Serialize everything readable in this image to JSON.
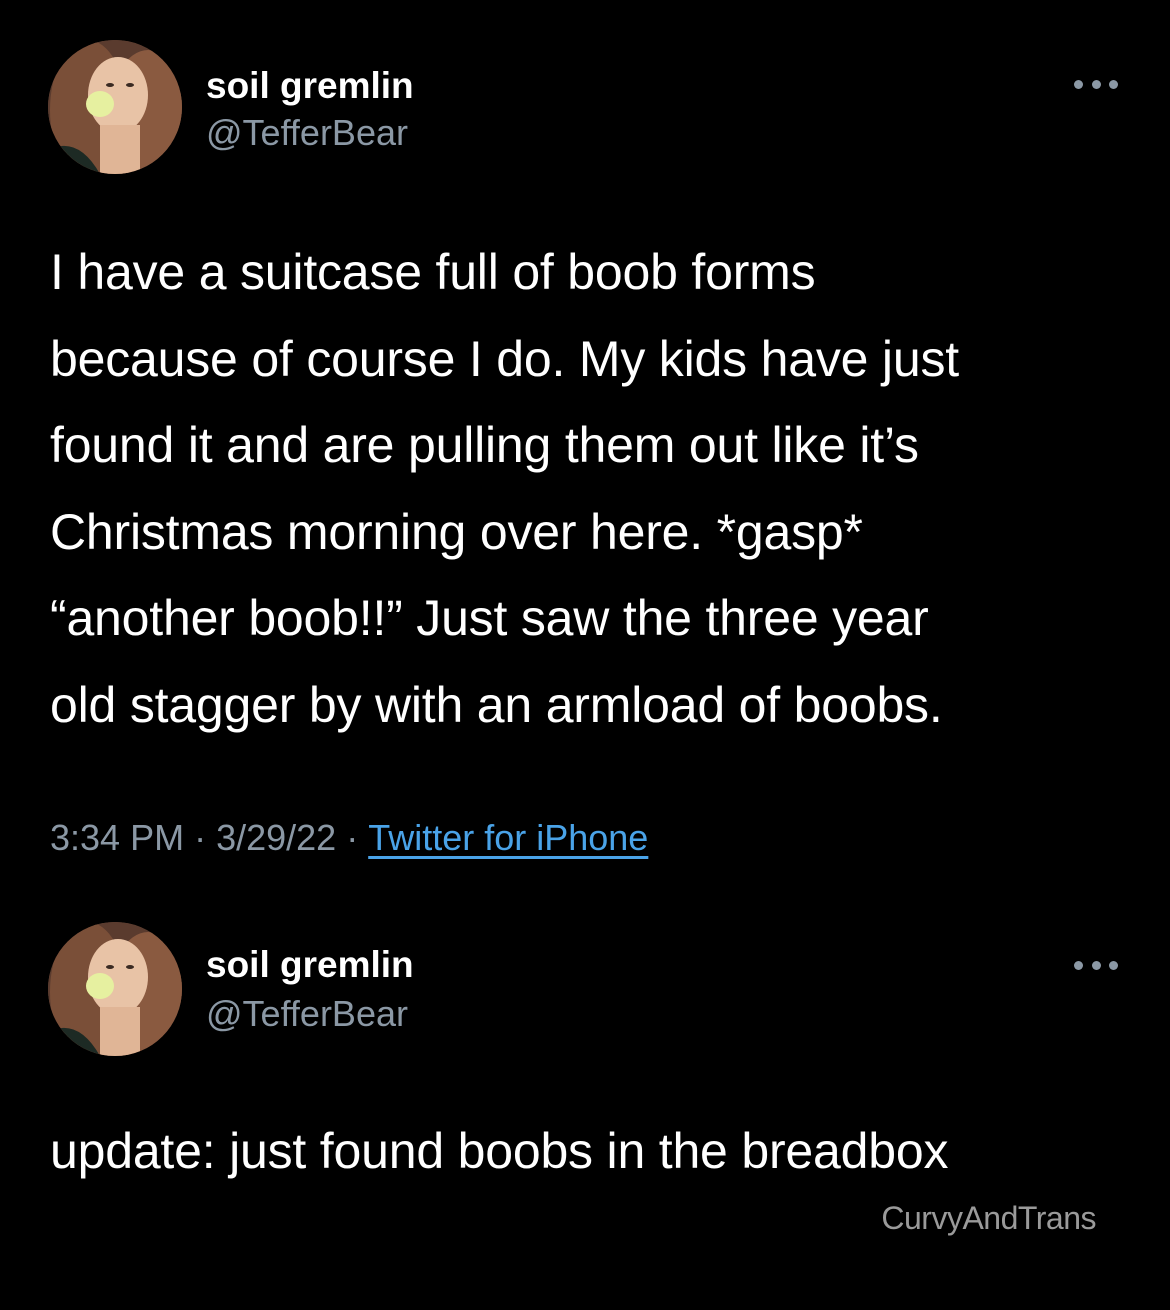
{
  "tweets": [
    {
      "display_name": "soil gremlin",
      "handle": "@TefferBear",
      "text": "I have a suitcase full of boob forms\nbecause of course I do. My kids have just\nfound it and are pulling them out like it’s\nChristmas morning over here. *gasp*\n“another boob!!” Just saw the three year\nold stagger by with an armload of boobs.",
      "time": "3:34 PM",
      "separator": "·",
      "date": "3/29/22",
      "source": "Twitter for iPhone"
    },
    {
      "display_name": "soil gremlin",
      "handle": "@TefferBear",
      "text": "update: just found boobs in the breadbox"
    }
  ],
  "watermark": "CurvyAndTrans",
  "colors": {
    "background": "#000000",
    "text": "#ffffff",
    "secondary": "#8b98a5",
    "link": "#4aa3e8"
  },
  "icons": {
    "more": "more-horizontal-icon"
  }
}
